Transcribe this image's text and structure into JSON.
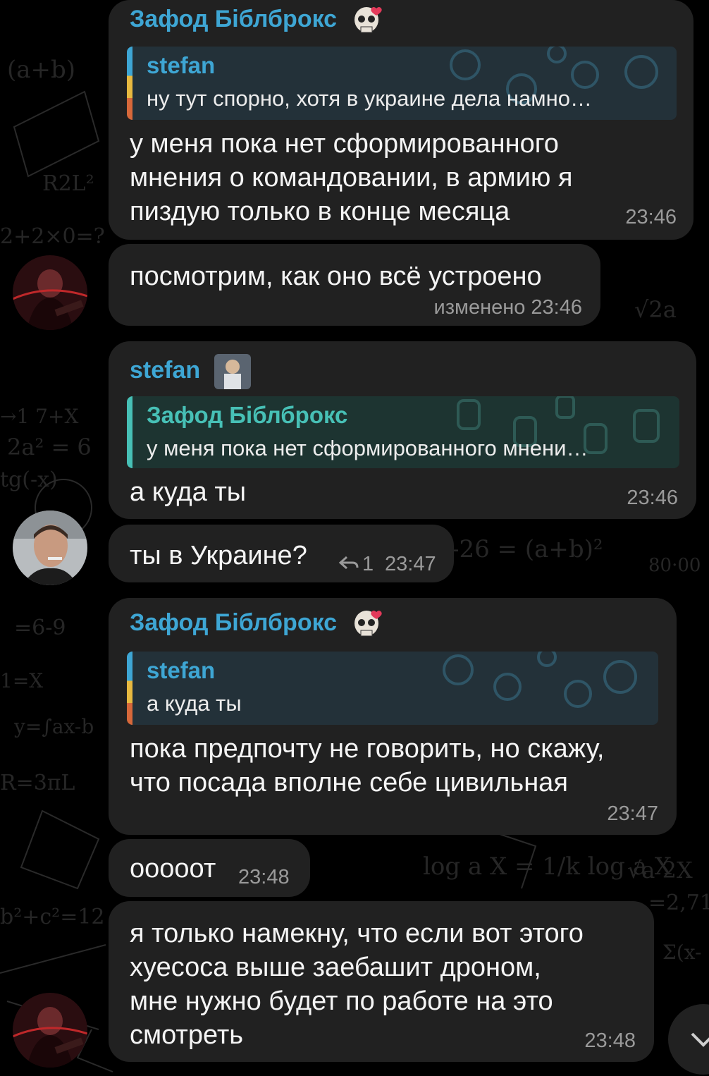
{
  "messages": [
    {
      "sender": "Зафод Біблброкс",
      "reply": {
        "name": "stefan",
        "text": "ну тут спорно, хотя в украине дела намно…"
      },
      "lines": [
        "у меня пока нет сформированного",
        "мнения о командовании, в армию я",
        "пиздую только в конце месяца"
      ],
      "time": "23:46"
    },
    {
      "lines": [
        "посмотрим, как оно всё устроено"
      ],
      "time": "изменено 23:46"
    },
    {
      "sender": "stefan",
      "reply": {
        "name": "Зафод Біблброкс",
        "text": "у меня пока нет сформированного мнени…"
      },
      "lines": [
        "а куда ты"
      ],
      "time": "23:46"
    },
    {
      "lines": [
        "ты в Украине?"
      ],
      "reply_count": "1",
      "time": "23:47"
    },
    {
      "sender": "Зафод Біблброкс",
      "reply": {
        "name": "stefan",
        "text": "а куда ты"
      },
      "lines": [
        "пока предпочту не говорить, но скажу,",
        "что посада вполне себе цивильная"
      ],
      "time": "23:47"
    },
    {
      "lines": [
        "ооооот"
      ],
      "time": "23:48"
    },
    {
      "lines": [
        "я только намекну, что если вот этого",
        "хуесоса выше заебашит дроном,",
        "мне нужно будет по работе на это",
        "смотреть"
      ],
      "time": "23:48"
    }
  ],
  "icons": {
    "sender_badge": "skull-emoji-icon",
    "reply_arrow": "reply-arrow-icon",
    "scroll_down": "chevron-down-icon"
  },
  "colors": {
    "background": "#000000",
    "bubble": "#212121",
    "sender_blue": "#3ea6d4",
    "sender_teal": "#47c0b6",
    "time": "#9a9a9a"
  }
}
